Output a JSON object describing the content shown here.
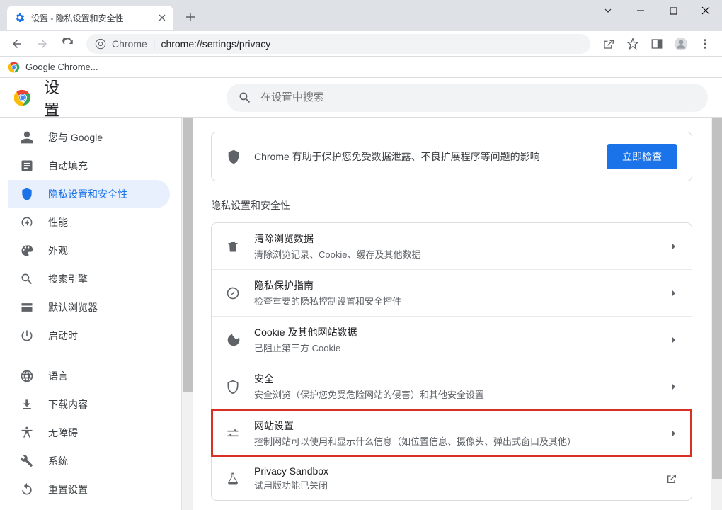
{
  "window": {
    "tab_title": "设置 - 隐私设置和安全性",
    "bookmark_label": "Google Chrome..."
  },
  "addressbar": {
    "chrome_label": "Chrome",
    "url": "chrome://settings/privacy"
  },
  "settings": {
    "title": "设置",
    "search_placeholder": "在设置中搜索"
  },
  "sidebar": {
    "items": [
      {
        "label": "您与 Google"
      },
      {
        "label": "自动填充"
      },
      {
        "label": "隐私设置和安全性"
      },
      {
        "label": "性能"
      },
      {
        "label": "外观"
      },
      {
        "label": "搜索引擎"
      },
      {
        "label": "默认浏览器"
      },
      {
        "label": "启动时"
      },
      {
        "label": "语言"
      },
      {
        "label": "下载内容"
      },
      {
        "label": "无障碍"
      },
      {
        "label": "系统"
      },
      {
        "label": "重置设置"
      }
    ]
  },
  "banner": {
    "text": "Chrome 有助于保护您免受数据泄露、不良扩展程序等问题的影响",
    "button": "立即检查"
  },
  "section": {
    "title": "隐私设置和安全性",
    "rows": [
      {
        "title": "清除浏览数据",
        "sub": "清除浏览记录、Cookie、缓存及其他数据"
      },
      {
        "title": "隐私保护指南",
        "sub": "检查重要的隐私控制设置和安全控件"
      },
      {
        "title": "Cookie 及其他网站数据",
        "sub": "已阻止第三方 Cookie"
      },
      {
        "title": "安全",
        "sub": "安全浏览（保护您免受危险网站的侵害）和其他安全设置"
      },
      {
        "title": "网站设置",
        "sub": "控制网站可以使用和显示什么信息（如位置信息、摄像头、弹出式窗口及其他）"
      },
      {
        "title": "Privacy Sandbox",
        "sub": "试用版功能已关闭"
      }
    ]
  }
}
